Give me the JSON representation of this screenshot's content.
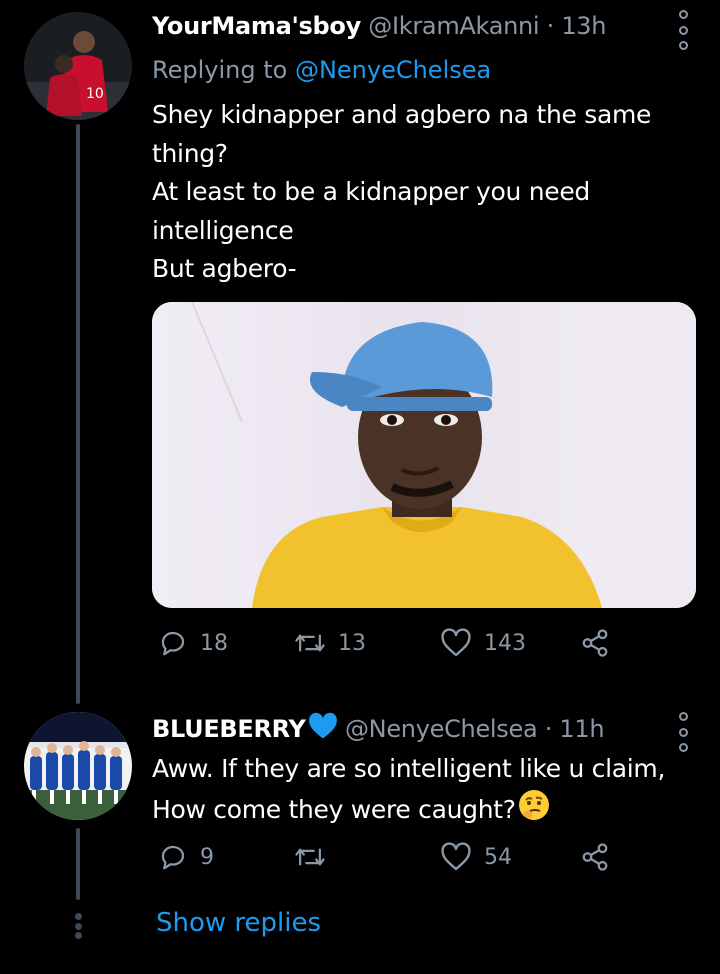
{
  "tweet1": {
    "display_name": "YourMama'sboy",
    "handle": "@IkramAkanni",
    "dot": "·",
    "time": "13h",
    "replying_prefix": "Replying to ",
    "replying_to": "@NenyeChelsea",
    "text_lines": [
      "Shey kidnapper and agbero na the same",
      "thing?",
      "At least to be a kidnapper you need",
      "intelligence",
      "But agbero-"
    ],
    "reply_count": "18",
    "retweet_count": "13",
    "like_count": "143"
  },
  "tweet2": {
    "display_name": "BLUEBERRY",
    "handle": "@NenyeChelsea",
    "dot": "·",
    "time": "11h",
    "text_lines": [
      "Aww. If they are so intelligent like u claim,",
      "How come they were caught?"
    ],
    "reply_count": "9",
    "retweet_count": "",
    "like_count": "54"
  },
  "show_replies": "Show replies",
  "colors": {
    "background": "#000000",
    "text_primary": "#ffffff",
    "text_secondary": "#8b98a5",
    "accent": "#1d9bf0",
    "thread_line": "#3d4a55"
  },
  "icons": [
    "more-icon",
    "reply-icon",
    "retweet-icon",
    "like-icon",
    "share-icon",
    "blue-heart-emoji",
    "thinking-face-emoji"
  ]
}
